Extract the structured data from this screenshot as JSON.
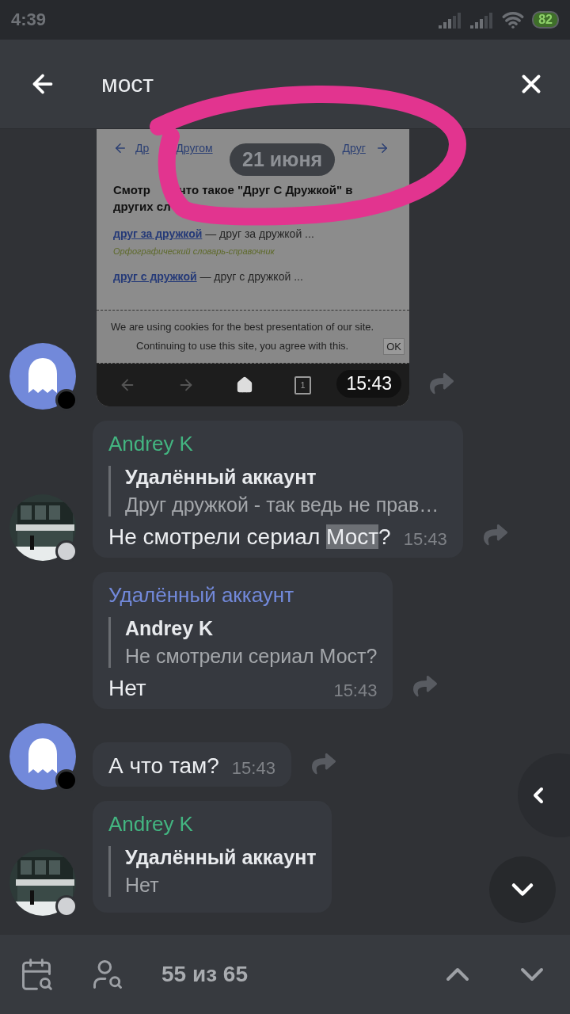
{
  "status_bar": {
    "time": "4:39",
    "battery": "82"
  },
  "search": {
    "query": "мост"
  },
  "date_badge": "21 июня",
  "messages": [
    {
      "avatar": {
        "kind": "ghost"
      },
      "time": "15:43",
      "screenshot": {
        "nav_prev": "Др",
        "nav_prev_rest": "Другом",
        "nav_next": "Друг",
        "heading_start": "Смотр",
        "heading_rest": "что такое \"Друг С Дружкой\" в",
        "heading_line2": "других сл",
        "entries": [
          {
            "term": "друг за дружкой",
            "definition": "— друг за дружкой ...",
            "source": "Орфографический словарь-справочник"
          },
          {
            "term": "друг с дружкой",
            "definition": "— друг с дружкой ..."
          }
        ],
        "cookie_text": "We are using cookies for the best presentation of our site. Continuing to use this site, you agree with this.",
        "cookie_button": "OK",
        "tab_count": "1"
      }
    },
    {
      "kind": "text",
      "author": "Andrey K",
      "color": "#43b581",
      "reply": {
        "author": "Удалённый аккаунт",
        "text": "Друг дружкой - так ведь не прав…"
      },
      "body": [
        {
          "text": "Не смотрели сериал ",
          "highlighted": false
        },
        {
          "text": "Мост",
          "highlighted": true
        },
        {
          "text": "?",
          "highlighted": false
        }
      ],
      "time": "15:43"
    },
    {
      "kind": "text",
      "author": "Удалённый аккаунт",
      "color": "#7289da",
      "reply": {
        "author": "Andrey K",
        "text": "Не смотрели сериал Мост?"
      },
      "body": [
        {
          "text": "Нет",
          "highlighted": false
        }
      ],
      "time": "15:43"
    },
    {
      "kind": "text",
      "avatar": {
        "kind": "ghost"
      },
      "body": [
        {
          "text": "А что там?",
          "highlighted": false
        }
      ],
      "time": "15:43"
    },
    {
      "kind": "text",
      "author": "Andrey K",
      "color": "#43b581",
      "reply": {
        "author": "Удалённый аккаунт",
        "text": "Нет"
      }
    }
  ],
  "counter": "55 из 65"
}
